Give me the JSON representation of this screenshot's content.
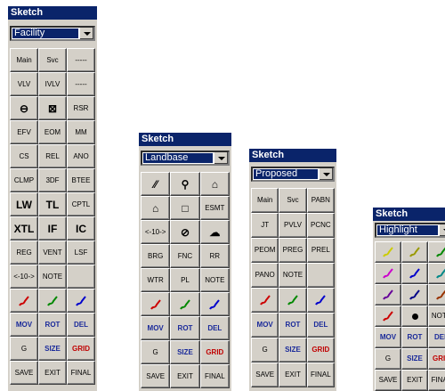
{
  "palettes": [
    {
      "title": "Sketch",
      "selected": "Facility",
      "buttons": [
        {
          "label": "Main",
          "kind": "txt"
        },
        {
          "label": "Svc",
          "kind": "txt"
        },
        {
          "label": "-----",
          "kind": "txt"
        },
        {
          "label": "VLV",
          "kind": "txt"
        },
        {
          "label": "IVLV",
          "kind": "txt"
        },
        {
          "label": "-----",
          "kind": "txt"
        },
        {
          "label": "⊖",
          "kind": "big"
        },
        {
          "label": "⊠",
          "kind": "big"
        },
        {
          "label": "RSR",
          "kind": "txt"
        },
        {
          "label": "EFV",
          "kind": "txt"
        },
        {
          "label": "EOM",
          "kind": "txt"
        },
        {
          "label": "MM",
          "kind": "txt"
        },
        {
          "label": "CS",
          "kind": "txt"
        },
        {
          "label": "REL",
          "kind": "txt"
        },
        {
          "label": "ANO",
          "kind": "txt"
        },
        {
          "label": "CLMP",
          "kind": "txt"
        },
        {
          "label": "3DF",
          "kind": "txt"
        },
        {
          "label": "BTEE",
          "kind": "txt"
        },
        {
          "label": "LW",
          "kind": "big"
        },
        {
          "label": "TL",
          "kind": "big"
        },
        {
          "label": "CPTL",
          "kind": "txt"
        },
        {
          "label": "XTL",
          "kind": "big"
        },
        {
          "label": "IF",
          "kind": "big"
        },
        {
          "label": "IC",
          "kind": "big"
        },
        {
          "label": "REG",
          "kind": "txt"
        },
        {
          "label": "VENT",
          "kind": "txt"
        },
        {
          "label": "LSF",
          "kind": "txt"
        },
        {
          "label": "<-10->",
          "kind": "txt"
        },
        {
          "label": "NOTE",
          "kind": "txt"
        },
        {
          "label": "",
          "kind": "empty"
        },
        {
          "label": "pen-red",
          "kind": "pen"
        },
        {
          "label": "pen-green",
          "kind": "pen"
        },
        {
          "label": "pen-blue",
          "kind": "pen"
        },
        {
          "label": "MOV",
          "kind": "blue"
        },
        {
          "label": "ROT",
          "kind": "blue"
        },
        {
          "label": "DEL",
          "kind": "blue"
        },
        {
          "label": "G",
          "kind": "G"
        },
        {
          "label": "SIZE",
          "kind": "blue"
        },
        {
          "label": "GRID",
          "kind": "red"
        },
        {
          "label": "SAVE",
          "kind": "txt"
        },
        {
          "label": "EXIT",
          "kind": "txt"
        },
        {
          "label": "FINAL",
          "kind": "txt"
        }
      ]
    },
    {
      "title": "Sketch",
      "selected": "Landbase",
      "buttons": [
        {
          "label": "⁄⁄",
          "kind": "big"
        },
        {
          "label": "⚲",
          "kind": "big"
        },
        {
          "label": "⌂",
          "kind": "big"
        },
        {
          "label": "⌂",
          "kind": "big"
        },
        {
          "label": "□",
          "kind": "big"
        },
        {
          "label": "ESMT",
          "kind": "txt"
        },
        {
          "label": "<-10->",
          "kind": "txt"
        },
        {
          "label": "⊘",
          "kind": "big"
        },
        {
          "label": "☁",
          "kind": "big"
        },
        {
          "label": "BRG",
          "kind": "txt"
        },
        {
          "label": "FNC",
          "kind": "txt"
        },
        {
          "label": "RR",
          "kind": "txt"
        },
        {
          "label": "WTR",
          "kind": "txt"
        },
        {
          "label": "PL",
          "kind": "txt"
        },
        {
          "label": "NOTE",
          "kind": "txt"
        },
        {
          "label": "pen-red",
          "kind": "pen"
        },
        {
          "label": "pen-green",
          "kind": "pen"
        },
        {
          "label": "pen-blue",
          "kind": "pen"
        },
        {
          "label": "MOV",
          "kind": "blue"
        },
        {
          "label": "ROT",
          "kind": "blue"
        },
        {
          "label": "DEL",
          "kind": "blue"
        },
        {
          "label": "G",
          "kind": "G"
        },
        {
          "label": "SIZE",
          "kind": "blue"
        },
        {
          "label": "GRID",
          "kind": "red"
        },
        {
          "label": "SAVE",
          "kind": "txt"
        },
        {
          "label": "EXIT",
          "kind": "txt"
        },
        {
          "label": "FINAL",
          "kind": "txt"
        }
      ]
    },
    {
      "title": "Sketch",
      "selected": "Proposed",
      "buttons": [
        {
          "label": "Main",
          "kind": "txt"
        },
        {
          "label": "Svc",
          "kind": "txt"
        },
        {
          "label": "PABN",
          "kind": "txt"
        },
        {
          "label": "JT",
          "kind": "txt"
        },
        {
          "label": "PVLV",
          "kind": "txt"
        },
        {
          "label": "PCNC",
          "kind": "txt"
        },
        {
          "label": "PEOM",
          "kind": "txt"
        },
        {
          "label": "PREG",
          "kind": "txt"
        },
        {
          "label": "PREL",
          "kind": "txt"
        },
        {
          "label": "PANO",
          "kind": "txt"
        },
        {
          "label": "NOTE",
          "kind": "txt"
        },
        {
          "label": "",
          "kind": "empty"
        },
        {
          "label": "pen-red",
          "kind": "pen"
        },
        {
          "label": "pen-green",
          "kind": "pen"
        },
        {
          "label": "pen-blue",
          "kind": "pen"
        },
        {
          "label": "MOV",
          "kind": "blue"
        },
        {
          "label": "ROT",
          "kind": "blue"
        },
        {
          "label": "DEL",
          "kind": "blue"
        },
        {
          "label": "G",
          "kind": "G"
        },
        {
          "label": "SIZE",
          "kind": "blue"
        },
        {
          "label": "GRID",
          "kind": "red"
        },
        {
          "label": "SAVE",
          "kind": "txt"
        },
        {
          "label": "EXIT",
          "kind": "txt"
        },
        {
          "label": "FINAL",
          "kind": "txt"
        }
      ]
    },
    {
      "title": "Sketch",
      "selected": "Highlight",
      "buttons": [
        {
          "label": "pen-yellow",
          "kind": "pen"
        },
        {
          "label": "pen-olive",
          "kind": "pen"
        },
        {
          "label": "pen-green",
          "kind": "pen"
        },
        {
          "label": "pen-magenta",
          "kind": "pen"
        },
        {
          "label": "pen-blue",
          "kind": "pen"
        },
        {
          "label": "pen-teal",
          "kind": "pen"
        },
        {
          "label": "pen-purple",
          "kind": "pen"
        },
        {
          "label": "pen-navy",
          "kind": "pen"
        },
        {
          "label": "pen-brown",
          "kind": "pen"
        },
        {
          "label": "pen-red",
          "kind": "pen"
        },
        {
          "label": "dot",
          "kind": "dot"
        },
        {
          "label": "NOTE",
          "kind": "txt"
        },
        {
          "label": "MOV",
          "kind": "blue"
        },
        {
          "label": "ROT",
          "kind": "blue"
        },
        {
          "label": "DEL",
          "kind": "blue"
        },
        {
          "label": "G",
          "kind": "G"
        },
        {
          "label": "SIZE",
          "kind": "blue"
        },
        {
          "label": "GRID",
          "kind": "red"
        },
        {
          "label": "SAVE",
          "kind": "txt"
        },
        {
          "label": "EXIT",
          "kind": "txt"
        },
        {
          "label": "FINAL",
          "kind": "txt"
        }
      ]
    }
  ],
  "colors": {
    "titlebar": "#0a246a",
    "face": "#d4d0c8",
    "pen-red": "#cc0000",
    "pen-green": "#008800",
    "pen-blue": "#0000cc",
    "pen-yellow": "#cccc00",
    "pen-olive": "#999900",
    "pen-magenta": "#cc00cc",
    "pen-teal": "#008888",
    "pen-purple": "#660099",
    "pen-navy": "#000088",
    "pen-brown": "#993300"
  }
}
